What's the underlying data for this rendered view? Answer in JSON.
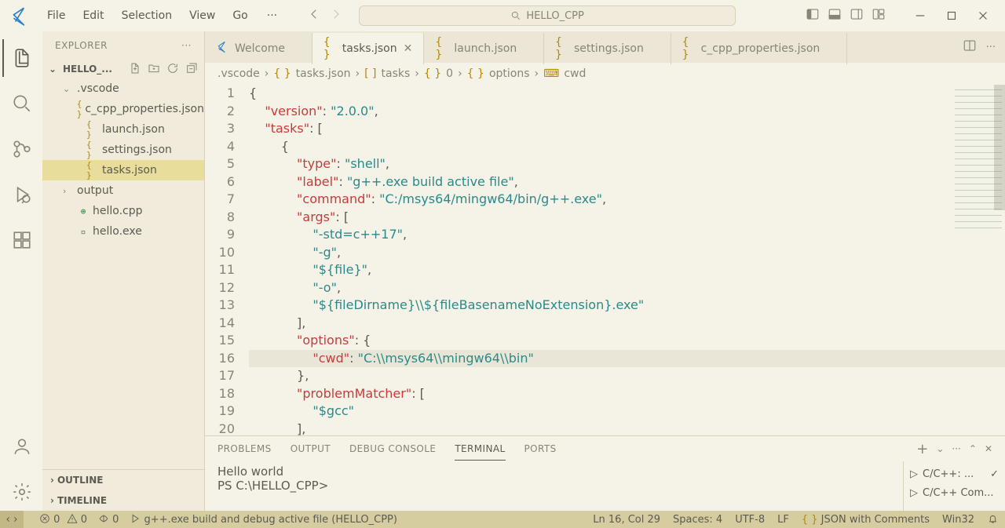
{
  "titlebar": {
    "menu": [
      "File",
      "Edit",
      "Selection",
      "View",
      "Go"
    ],
    "search_label": "HELLO_CPP"
  },
  "sidebar": {
    "header": "EXPLORER",
    "workspace": "HELLO_...",
    "tree": [
      {
        "type": "folder",
        "name": ".vscode",
        "expanded": true,
        "depth": 0
      },
      {
        "type": "file",
        "name": "c_cpp_properties.json",
        "icon": "json",
        "depth": 1
      },
      {
        "type": "file",
        "name": "launch.json",
        "icon": "json",
        "depth": 1
      },
      {
        "type": "file",
        "name": "settings.json",
        "icon": "json",
        "depth": 1
      },
      {
        "type": "file",
        "name": "tasks.json",
        "icon": "json",
        "depth": 1,
        "selected": true
      },
      {
        "type": "folder",
        "name": "output",
        "expanded": false,
        "depth": 0
      },
      {
        "type": "file",
        "name": "hello.cpp",
        "icon": "cpp",
        "depth": 0
      },
      {
        "type": "file",
        "name": "hello.exe",
        "icon": "exe",
        "depth": 0
      }
    ],
    "bottom": [
      "OUTLINE",
      "TIMELINE"
    ]
  },
  "tabs": [
    {
      "label": "Welcome",
      "kind": "welcome"
    },
    {
      "label": "tasks.json",
      "kind": "json",
      "active": true,
      "dirty": false
    },
    {
      "label": "launch.json",
      "kind": "json"
    },
    {
      "label": "settings.json",
      "kind": "json"
    },
    {
      "label": "c_cpp_properties.json",
      "kind": "json"
    }
  ],
  "breadcrumb": [
    ".vscode",
    "tasks.json",
    "tasks",
    "0",
    "options",
    "cwd"
  ],
  "editor": {
    "current_line": 16,
    "lines": [
      {
        "n": 1,
        "indent": 0,
        "html": "<span class='tok-punc'>{</span>"
      },
      {
        "n": 2,
        "indent": 1,
        "html": "<span class='tok-key'>\"version\"</span><span class='tok-punc'>: </span><span class='tok-str'>\"2.0.0\"</span><span class='tok-punc'>,</span>"
      },
      {
        "n": 3,
        "indent": 1,
        "html": "<span class='tok-key'>\"tasks\"</span><span class='tok-punc'>: [</span>"
      },
      {
        "n": 4,
        "indent": 2,
        "html": "<span class='tok-punc'>{</span>"
      },
      {
        "n": 5,
        "indent": 3,
        "html": "<span class='tok-key'>\"type\"</span><span class='tok-punc'>: </span><span class='tok-str'>\"shell\"</span><span class='tok-punc'>,</span>"
      },
      {
        "n": 6,
        "indent": 3,
        "html": "<span class='tok-key'>\"label\"</span><span class='tok-punc'>: </span><span class='tok-str'>\"g++.exe build active file\"</span><span class='tok-punc'>,</span>"
      },
      {
        "n": 7,
        "indent": 3,
        "html": "<span class='tok-key'>\"command\"</span><span class='tok-punc'>: </span><span class='tok-str'>\"C:/msys64/mingw64/bin/g++.exe\"</span><span class='tok-punc'>,</span>"
      },
      {
        "n": 8,
        "indent": 3,
        "html": "<span class='tok-key'>\"args\"</span><span class='tok-punc'>: [</span>"
      },
      {
        "n": 9,
        "indent": 4,
        "html": "<span class='tok-str'>\"-std=c++17\"</span><span class='tok-punc'>,</span>"
      },
      {
        "n": 10,
        "indent": 4,
        "html": "<span class='tok-str'>\"-g\"</span><span class='tok-punc'>,</span>"
      },
      {
        "n": 11,
        "indent": 4,
        "html": "<span class='tok-str'>\"${file}\"</span><span class='tok-punc'>,</span>"
      },
      {
        "n": 12,
        "indent": 4,
        "html": "<span class='tok-str'>\"-o\"</span><span class='tok-punc'>,</span>"
      },
      {
        "n": 13,
        "indent": 4,
        "html": "<span class='tok-str'>\"${fileDirname}\\\\${fileBasenameNoExtension}.exe\"</span>"
      },
      {
        "n": 14,
        "indent": 3,
        "html": "<span class='tok-punc'>],</span>"
      },
      {
        "n": 15,
        "indent": 3,
        "html": "<span class='tok-key'>\"options\"</span><span class='tok-punc'>: {</span>"
      },
      {
        "n": 16,
        "indent": 4,
        "html": "<span class='tok-key'>\"cwd\"</span><span class='tok-punc'>: </span><span class='tok-str'>\"C:\\\\msys64\\\\mingw64\\\\bin\"</span>"
      },
      {
        "n": 17,
        "indent": 3,
        "html": "<span class='tok-punc'>},</span>"
      },
      {
        "n": 18,
        "indent": 3,
        "html": "<span class='tok-key'>\"problemMatcher\"</span><span class='tok-punc'>: [</span>"
      },
      {
        "n": 19,
        "indent": 4,
        "html": "<span class='tok-str'>\"$gcc\"</span>"
      },
      {
        "n": 20,
        "indent": 3,
        "html": "<span class='tok-punc'>],</span>"
      }
    ]
  },
  "panel": {
    "tabs": [
      "PROBLEMS",
      "OUTPUT",
      "DEBUG CONSOLE",
      "TERMINAL",
      "PORTS"
    ],
    "active": "TERMINAL",
    "terminal_lines": [
      "Hello world",
      "PS C:\\HELLO_CPP>"
    ],
    "side": [
      "C/C++: ...",
      "C/C++ Com..."
    ]
  },
  "statusbar": {
    "errors": "0",
    "warnings": "0",
    "ports": "0",
    "build": "g++.exe build and debug active file (HELLO_CPP)",
    "pos": "Ln 16, Col 29",
    "spaces": "Spaces: 4",
    "encoding": "UTF-8",
    "eol": "LF",
    "lang": "JSON with Comments",
    "platform": "Win32"
  }
}
